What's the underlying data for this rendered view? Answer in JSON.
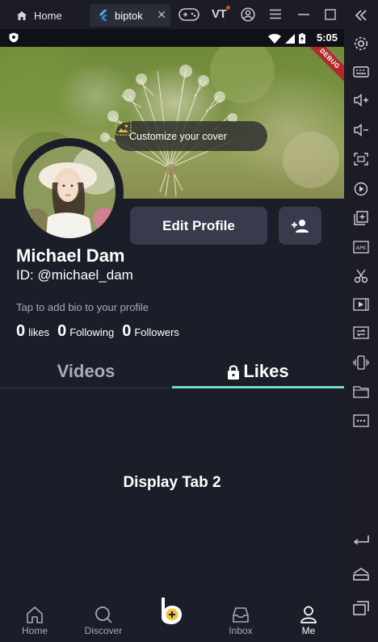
{
  "window": {
    "home_tab_label": "Home",
    "app_tab_label": "biptok",
    "vt_label": "VT"
  },
  "status": {
    "time": "5:05",
    "debug_label": "DEBUG"
  },
  "cover": {
    "customize_label": "Customize your cover"
  },
  "profile": {
    "edit_button_label": "Edit Profile",
    "name": "Michael Dam",
    "user_id": "ID: @michael_dam",
    "bio_placeholder": "Tap to add bio to your profile",
    "stats": [
      {
        "value": "0",
        "label": "likes"
      },
      {
        "value": "0",
        "label": "Following"
      },
      {
        "value": "0",
        "label": "Followers"
      }
    ]
  },
  "tabs": [
    {
      "label": "Videos"
    },
    {
      "label": "Likes"
    }
  ],
  "content": {
    "label": "Display Tab 2"
  },
  "bottom_nav": [
    {
      "label": "Home",
      "icon": "home-icon"
    },
    {
      "label": "Discover",
      "icon": "search-icon"
    },
    {
      "label": "",
      "icon": "create-icon"
    },
    {
      "label": "Inbox",
      "icon": "inbox-icon"
    },
    {
      "label": "Me",
      "icon": "person-icon"
    }
  ],
  "colors": {
    "background": "#1b1d28",
    "button": "#383b4c",
    "accent": "#6fdac8",
    "muted_text": "#a7a9b6"
  }
}
